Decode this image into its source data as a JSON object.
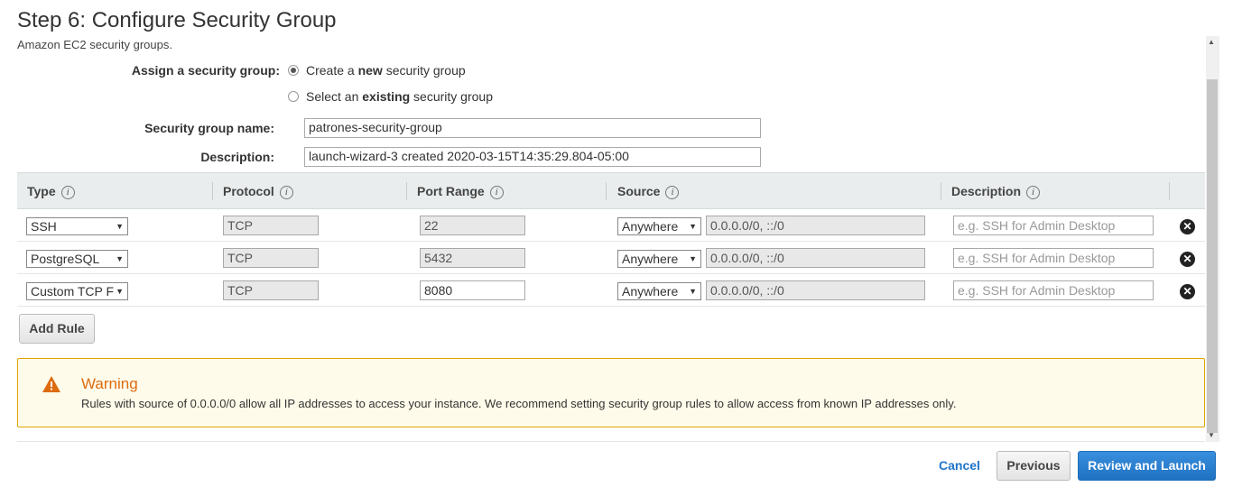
{
  "header": {
    "title": "Step 6: Configure Security Group",
    "subtitle": "Amazon EC2 security groups."
  },
  "assign": {
    "label": "Assign a security group:",
    "options": [
      {
        "pre": "Create a ",
        "bold": "new",
        "post": " security group",
        "selected": true
      },
      {
        "pre": "Select an ",
        "bold": "existing",
        "post": " security group",
        "selected": false
      }
    ]
  },
  "form": {
    "name_label": "Security group name:",
    "name_value": "patrones-security-group",
    "description_label": "Description:",
    "description_value": "launch-wizard-3 created 2020-03-15T14:35:29.804-05:00"
  },
  "table": {
    "headers": [
      "Type",
      "Protocol",
      "Port Range",
      "Source",
      "Description"
    ],
    "info_glyph": "i",
    "remove_glyph": "✕",
    "rows": [
      {
        "type": "SSH",
        "protocol": "TCP",
        "port": "22",
        "port_editable": false,
        "source": "Anywhere",
        "cidr": "0.0.0.0/0, ::/0",
        "description_placeholder": "e.g. SSH for Admin Desktop"
      },
      {
        "type": "PostgreSQL",
        "protocol": "TCP",
        "port": "5432",
        "port_editable": false,
        "source": "Anywhere",
        "cidr": "0.0.0.0/0, ::/0",
        "description_placeholder": "e.g. SSH for Admin Desktop"
      },
      {
        "type": "Custom TCP F",
        "protocol": "TCP",
        "port": "8080",
        "port_editable": true,
        "source": "Anywhere",
        "cidr": "0.0.0.0/0, ::/0",
        "description_placeholder": "e.g. SSH for Admin Desktop"
      }
    ]
  },
  "add_rule_label": "Add Rule",
  "warning": {
    "title": "Warning",
    "text": "Rules with source of 0.0.0.0/0 allow all IP addresses to access your instance. We recommend setting security group rules to allow access from known IP addresses only."
  },
  "footer": {
    "cancel": "Cancel",
    "previous": "Previous",
    "review": "Review and Launch"
  },
  "colors": {
    "accent": "#1f72c2",
    "warning": "#dd6b10",
    "link": "#2074c9"
  }
}
